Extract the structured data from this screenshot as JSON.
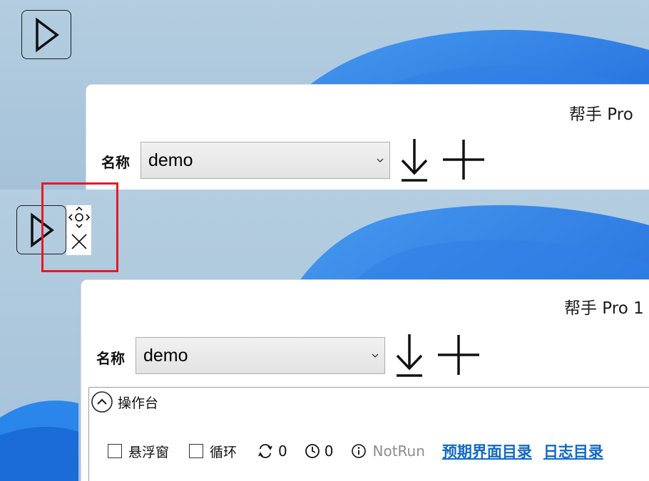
{
  "top_window": {
    "title": "帮手 Pro",
    "name_label": "名称",
    "name_value": "demo"
  },
  "bottom_window": {
    "title": "帮手 Pro 1",
    "name_label": "名称",
    "name_value": "demo",
    "console": {
      "label": "操作台",
      "floating_window_label": "悬浮窗",
      "loop_label": "循环",
      "loop_count": "0",
      "timer_count": "0",
      "status": "NotRun",
      "expected_ui_dir_link": "预期界面目录",
      "log_dir_link": "日志目录"
    }
  },
  "colors": {
    "link": "#1269c4",
    "highlight": "#e11c24",
    "status": "#8c8c8c"
  },
  "icons": [
    "play-icon",
    "download-icon",
    "add-icon",
    "move-icon",
    "close-icon",
    "collapse-icon",
    "loop-icon",
    "clock-icon",
    "info-icon"
  ]
}
